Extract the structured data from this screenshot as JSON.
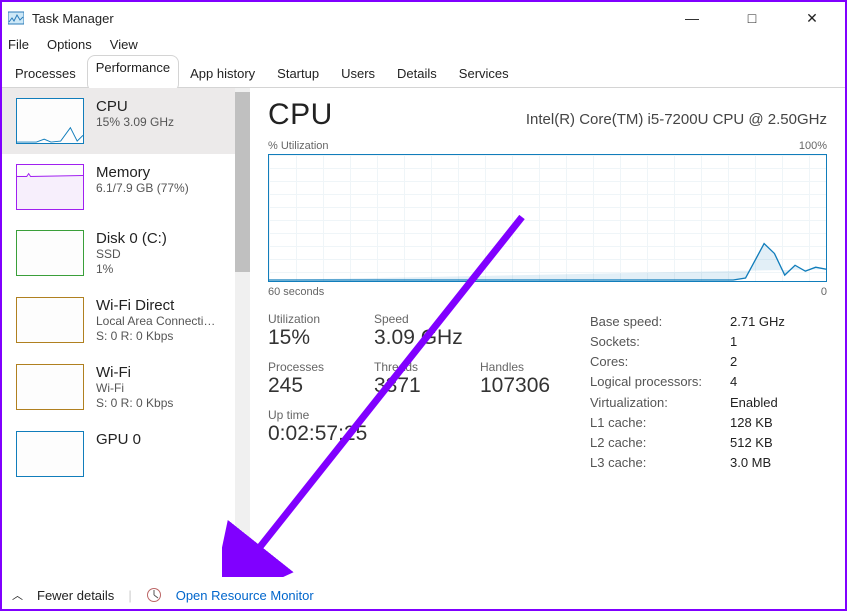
{
  "window": {
    "title": "Task Manager",
    "minimize": "—",
    "maximize": "□",
    "close": "✕"
  },
  "menu": {
    "file": "File",
    "options": "Options",
    "view": "View"
  },
  "tabs": {
    "processes": "Processes",
    "performance": "Performance",
    "appHistory": "App history",
    "startup": "Startup",
    "users": "Users",
    "details": "Details",
    "services": "Services"
  },
  "sidebar": [
    {
      "title": "CPU",
      "sub": "15%  3.09 GHz"
    },
    {
      "title": "Memory",
      "sub": "6.1/7.9 GB (77%)"
    },
    {
      "title": "Disk 0 (C:)",
      "sub1": "SSD",
      "sub2": "1%"
    },
    {
      "title": "Wi-Fi Direct",
      "sub1": "Local Area Connecti…",
      "sub2": "S: 0  R: 0 Kbps"
    },
    {
      "title": "Wi-Fi",
      "sub1": "Wi-Fi",
      "sub2": "S: 0  R: 0 Kbps"
    },
    {
      "title": "GPU 0",
      "sub1": ""
    }
  ],
  "main": {
    "heading": "CPU",
    "chip": "Intel(R) Core(TM) i5-7200U CPU @ 2.50GHz",
    "graphLabelLeft": "% Utilization",
    "graphLabelRight": "100%",
    "xLeft": "60 seconds",
    "xRight": "0",
    "stats": {
      "utilization_l": "Utilization",
      "utilization_v": "15%",
      "speed_l": "Speed",
      "speed_v": "3.09 GHz",
      "processes_l": "Processes",
      "processes_v": "245",
      "threads_l": "Threads",
      "threads_v": "3371",
      "handles_l": "Handles",
      "handles_v": "107306",
      "uptime_l": "Up time",
      "uptime_v": "0:02:57:25"
    },
    "specs": {
      "base_l": "Base speed:",
      "base_v": "2.71 GHz",
      "sockets_l": "Sockets:",
      "sockets_v": "1",
      "cores_l": "Cores:",
      "cores_v": "2",
      "lp_l": "Logical processors:",
      "lp_v": "4",
      "virt_l": "Virtualization:",
      "virt_v": "Enabled",
      "l1_l": "L1 cache:",
      "l1_v": "128 KB",
      "l2_l": "L2 cache:",
      "l2_v": "512 KB",
      "l3_l": "L3 cache:",
      "l3_v": "3.0 MB"
    }
  },
  "footer": {
    "fewer": "Fewer details",
    "openRM": "Open Resource Monitor"
  },
  "chart_data": {
    "type": "line",
    "title": "% Utilization",
    "xlabel": "seconds",
    "ylabel": "% Utilization",
    "x_range": [
      60,
      0
    ],
    "ylim": [
      0,
      100
    ],
    "series": [
      {
        "name": "CPU",
        "x": [
          60,
          55,
          50,
          45,
          40,
          35,
          30,
          25,
          20,
          15,
          12,
          10,
          8,
          6,
          5,
          4,
          3,
          2,
          1,
          0
        ],
        "values": [
          1,
          1,
          1,
          1,
          1,
          1,
          1,
          1,
          1,
          1,
          2,
          3,
          5,
          30,
          25,
          5,
          12,
          8,
          10,
          9
        ]
      }
    ]
  }
}
